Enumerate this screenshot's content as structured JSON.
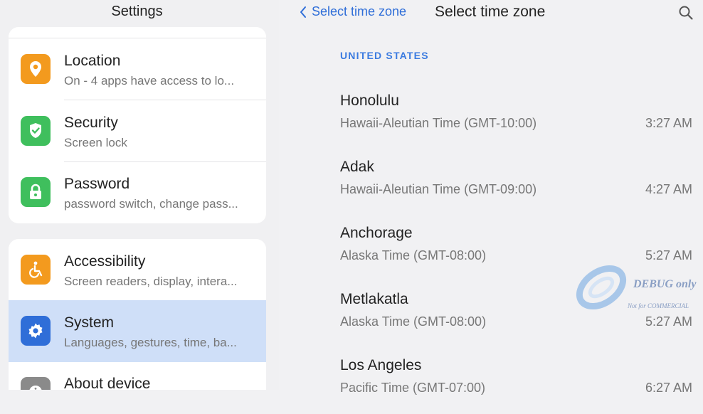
{
  "left": {
    "title": "Settings",
    "items": [
      {
        "title": "Location",
        "subtitle": "On - 4 apps have access to lo...",
        "icon": "location-pin-icon",
        "color": "#f39a1e"
      },
      {
        "title": "Security",
        "subtitle": "Screen lock",
        "icon": "shield-check-icon",
        "color": "#3fbf5d"
      },
      {
        "title": "Password",
        "subtitle": "password switch, change pass...",
        "icon": "lock-icon",
        "color": "#3fbf5d"
      },
      {
        "title": "Accessibility",
        "subtitle": "Screen readers, display, intera...",
        "icon": "accessibility-icon",
        "color": "#f39a1e"
      },
      {
        "title": "System",
        "subtitle": "Languages, gestures, time, ba...",
        "icon": "gear-icon",
        "color": "#2f6ed8",
        "selected": true
      },
      {
        "title": "About device",
        "subtitle": "",
        "icon": "info-icon",
        "color": "#8a8a8a"
      }
    ]
  },
  "right": {
    "back_label": "Select time zone",
    "title": "Select time zone",
    "section": "UNITED STATES",
    "zones": [
      {
        "city": "Honolulu",
        "desc": "Hawaii-Aleutian Time (GMT-10:00)",
        "time": "3:27 AM"
      },
      {
        "city": "Adak",
        "desc": "Hawaii-Aleutian Time (GMT-09:00)",
        "time": "4:27 AM"
      },
      {
        "city": "Anchorage",
        "desc": "Alaska Time (GMT-08:00)",
        "time": "5:27 AM"
      },
      {
        "city": "Metlakatla",
        "desc": "Alaska Time (GMT-08:00)",
        "time": "5:27 AM"
      },
      {
        "city": "Los Angeles",
        "desc": "Pacific Time (GMT-07:00)",
        "time": "6:27 AM"
      }
    ]
  },
  "watermark": {
    "line1": "DEBUG only",
    "line2": "Not for COMMERCIAL"
  }
}
